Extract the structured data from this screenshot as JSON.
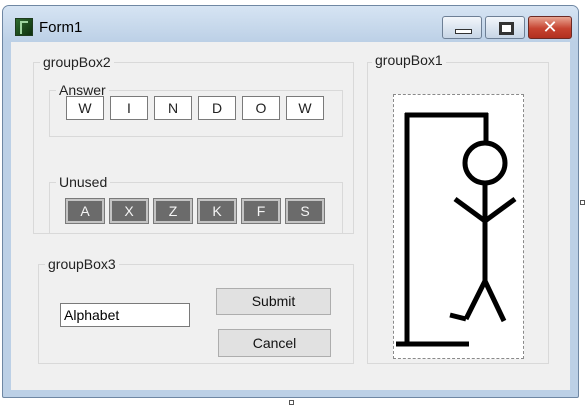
{
  "window": {
    "title": "Form1"
  },
  "titlebar_buttons": {
    "minimize": "minimize-icon",
    "maximize": "maximize-icon",
    "close": "close-icon",
    "close_glyph": "✕"
  },
  "groupBox2": {
    "title": "groupBox2",
    "answer": {
      "title": "Answer",
      "letters": [
        "W",
        "I",
        "N",
        "D",
        "O",
        "W"
      ]
    },
    "unused": {
      "title": "Unused",
      "letters": [
        "A",
        "X",
        "Z",
        "K",
        "F",
        "S"
      ]
    }
  },
  "groupBox3": {
    "title": "groupBox3",
    "input_value": "Alphabet",
    "submit_label": "Submit",
    "cancel_label": "Cancel"
  },
  "groupBox1": {
    "title": "groupBox1"
  },
  "colors": {
    "unused_fill": "#6b6b6b",
    "close_red": "#c64330"
  }
}
